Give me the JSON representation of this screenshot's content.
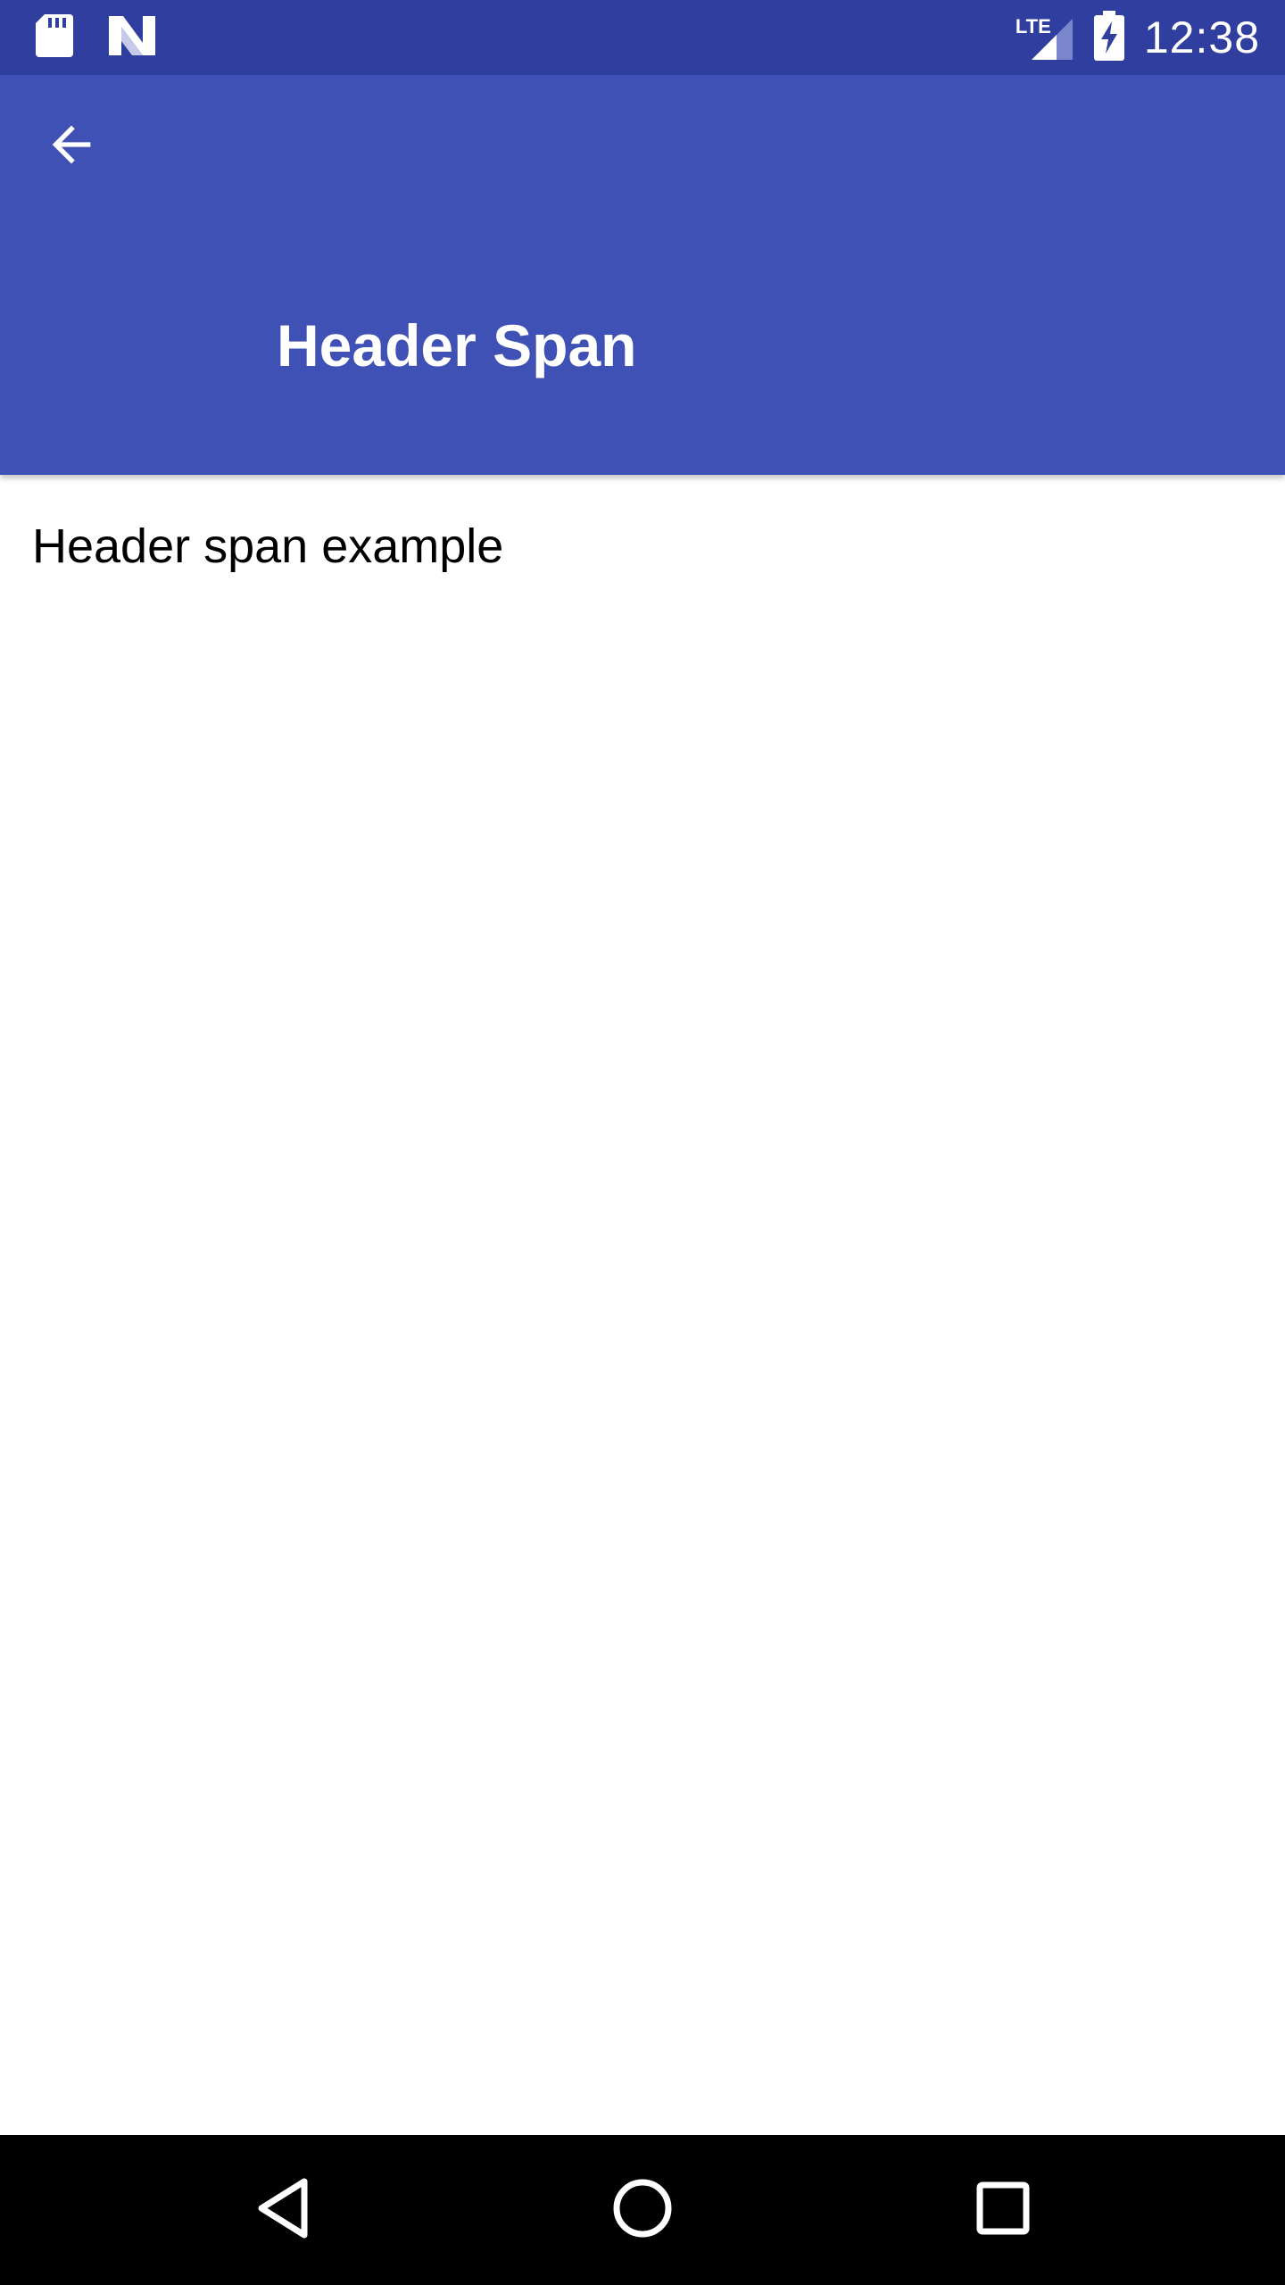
{
  "status_bar": {
    "time": "12:38",
    "network_label": "LTE",
    "icons": [
      "sd-card-icon",
      "n-logo-icon",
      "signal-icon",
      "battery-charging-icon"
    ]
  },
  "app_bar": {
    "title": "Header Span",
    "back_icon": "arrow-back-icon",
    "color": "#3f51b5"
  },
  "content": {
    "text": "Header span example"
  },
  "nav_bar": {
    "buttons": [
      "back-triangle-icon",
      "home-circle-icon",
      "recents-square-icon"
    ]
  },
  "colors": {
    "status_bar": "#303f9f",
    "app_bar": "#3f51b5",
    "nav_bar": "#000000",
    "background": "#ffffff"
  }
}
